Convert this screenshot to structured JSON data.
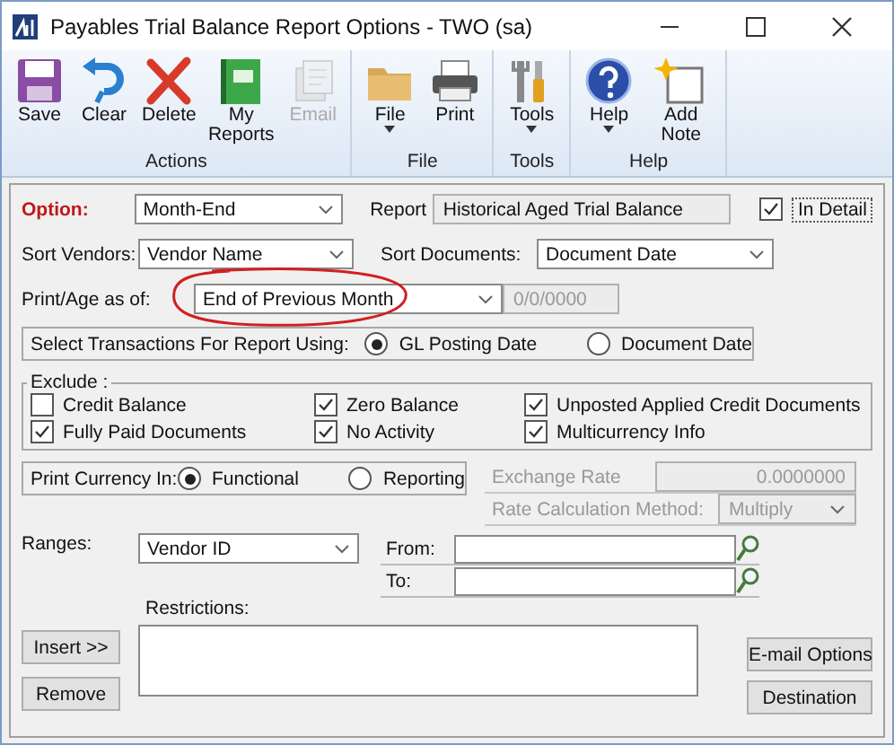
{
  "window": {
    "title": "Payables Trial Balance Report Options  -  TWO (sa)"
  },
  "toolbar": {
    "groups": [
      {
        "label": "Actions",
        "buttons": [
          {
            "kind": "save",
            "label": "Save",
            "disabled": false,
            "dropdown": false
          },
          {
            "kind": "clear",
            "label": "Clear",
            "disabled": false,
            "dropdown": false
          },
          {
            "kind": "delete",
            "label": "Delete",
            "disabled": false,
            "dropdown": false
          },
          {
            "kind": "reports",
            "label": "My Reports",
            "disabled": false,
            "dropdown": false
          },
          {
            "kind": "email",
            "label": "Email",
            "disabled": true,
            "dropdown": false
          }
        ]
      },
      {
        "label": "File",
        "buttons": [
          {
            "kind": "file",
            "label": "File",
            "disabled": false,
            "dropdown": true
          },
          {
            "kind": "print",
            "label": "Print",
            "disabled": false,
            "dropdown": false
          }
        ]
      },
      {
        "label": "Tools",
        "buttons": [
          {
            "kind": "tools",
            "label": "Tools",
            "disabled": false,
            "dropdown": true
          }
        ]
      },
      {
        "label": "Help",
        "buttons": [
          {
            "kind": "help",
            "label": "Help",
            "disabled": false,
            "dropdown": true
          },
          {
            "kind": "note",
            "label": "Add Note",
            "disabled": false,
            "dropdown": false
          }
        ]
      }
    ]
  },
  "option": {
    "label": "Option:",
    "value": "Month-End"
  },
  "report": {
    "label": "Report",
    "value": "Historical Aged Trial Balance"
  },
  "in_detail": {
    "label": "In Detail",
    "checked": true
  },
  "sort_vendors": {
    "label": "Sort Vendors:",
    "value": "Vendor Name"
  },
  "sort_documents": {
    "label": "Sort Documents:",
    "value": "Document Date"
  },
  "print_age": {
    "label": "Print/Age as of:",
    "value": "End of Previous Month",
    "date": "0/0/0000",
    "circled": true
  },
  "select_transactions": {
    "label": "Select Transactions For Report Using:",
    "options": [
      {
        "label": "GL Posting Date",
        "selected": true
      },
      {
        "label": "Document Date",
        "selected": false
      }
    ]
  },
  "exclude": {
    "label": "Exclude :",
    "options": [
      {
        "label": "Credit Balance",
        "checked": false
      },
      {
        "label": "Zero Balance",
        "checked": true
      },
      {
        "label": "Unposted Applied Credit Documents",
        "checked": true
      },
      {
        "label": "Fully Paid Documents",
        "checked": true
      },
      {
        "label": "No Activity",
        "checked": true
      },
      {
        "label": "Multicurrency Info",
        "checked": true
      }
    ]
  },
  "print_currency": {
    "label": "Print Currency In:",
    "options": [
      {
        "label": "Functional",
        "selected": true
      },
      {
        "label": "Reporting",
        "selected": false
      }
    ]
  },
  "exchange_rate": {
    "label": "Exchange Rate",
    "value": "0.0000000"
  },
  "rate_method": {
    "label": "Rate Calculation Method:",
    "value": "Multiply"
  },
  "ranges": {
    "label": "Ranges:",
    "value": "Vendor ID"
  },
  "from": {
    "label": "From:"
  },
  "to": {
    "label": "To:"
  },
  "restrictions": {
    "label": "Restrictions:"
  },
  "buttons": {
    "insert": "Insert >>",
    "remove": "Remove",
    "email_options": "E-mail Options",
    "destination": "Destination"
  }
}
